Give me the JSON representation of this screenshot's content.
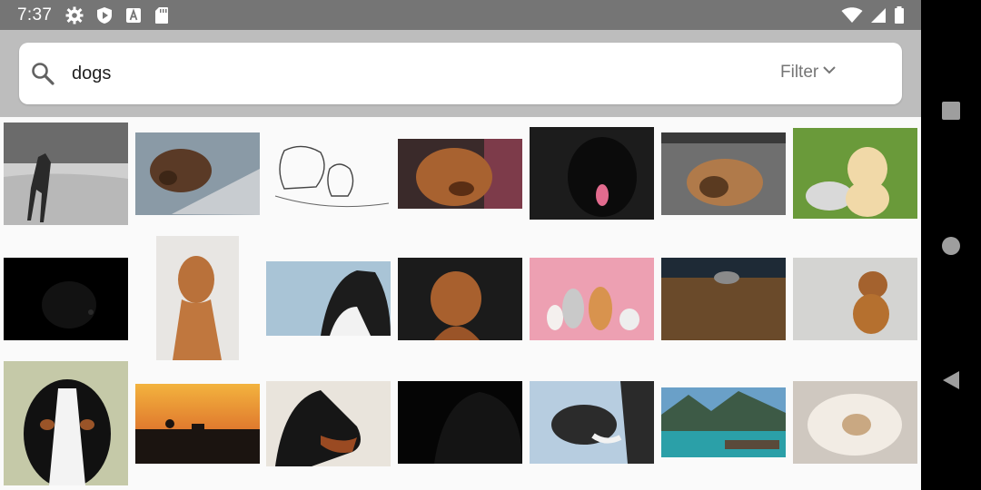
{
  "status_bar": {
    "time": "7:37",
    "left_icons": [
      "gear-icon",
      "shield-icon",
      "font-a-icon",
      "sd-card-icon"
    ],
    "right_icons": [
      "wifi-icon",
      "signal-icon",
      "battery-icon"
    ]
  },
  "search": {
    "query": "dogs",
    "filter_label": "Filter"
  },
  "images": [
    {
      "name": "image-weimaraner-beach"
    },
    {
      "name": "image-dog-on-laptop"
    },
    {
      "name": "image-dog-cat-sketch"
    },
    {
      "name": "image-brown-dog-closeup"
    },
    {
      "name": "image-black-retriever"
    },
    {
      "name": "image-bulldog-lying"
    },
    {
      "name": "image-golden-puppy"
    },
    {
      "name": "image-black-dog-dark"
    },
    {
      "name": "image-vizsla-portrait"
    },
    {
      "name": "image-husky-profile"
    },
    {
      "name": "image-vizsla-dark"
    },
    {
      "name": "image-puppies-pink"
    },
    {
      "name": "image-dog-on-floor"
    },
    {
      "name": "image-puppy-sitting"
    },
    {
      "name": "image-bernese"
    },
    {
      "name": "image-sunset-silhouette"
    },
    {
      "name": "image-doberman"
    },
    {
      "name": "image-black-dog-profile"
    },
    {
      "name": "image-dog-car-window"
    },
    {
      "name": "image-lake-mountains"
    },
    {
      "name": "image-fluffy-dog-rolling"
    }
  ],
  "nav": {
    "buttons": [
      "recents-square-icon",
      "home-circle-icon",
      "back-triangle-icon"
    ]
  }
}
